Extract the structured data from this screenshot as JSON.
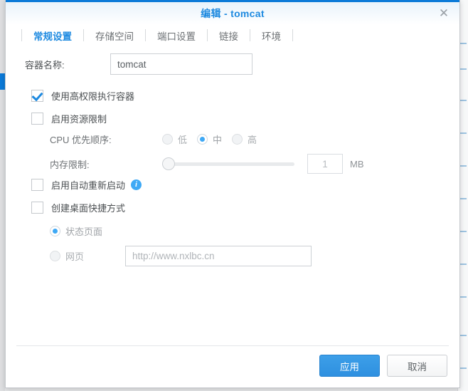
{
  "window": {
    "title": "编辑 - tomcat",
    "close_label": "✕"
  },
  "tabs": [
    {
      "label": "常规设置",
      "active": true
    },
    {
      "label": "存储空间",
      "active": false
    },
    {
      "label": "端口设置",
      "active": false
    },
    {
      "label": "链接",
      "active": false
    },
    {
      "label": "环境",
      "active": false
    }
  ],
  "form": {
    "container_name": {
      "label": "容器名称:",
      "value": "tomcat",
      "placeholder": ""
    },
    "high_privilege": {
      "label": "使用高权限执行容器",
      "checked": true
    },
    "resource_limit": {
      "label": "启用资源限制",
      "checked": false
    },
    "cpu_priority": {
      "label": "CPU 优先顺序:",
      "options": [
        "低",
        "中",
        "高"
      ],
      "selected": "中"
    },
    "memory_limit": {
      "label": "内存限制:",
      "value": "1",
      "unit": "MB",
      "slider_percent": 0
    },
    "auto_restart": {
      "label": "启用自动重新启动",
      "checked": false,
      "info_glyph": "i"
    },
    "desktop_shortcut": {
      "label": "创建桌面快捷方式",
      "checked": false
    },
    "shortcut_target": {
      "options": [
        {
          "label": "状态页面",
          "selected": true
        },
        {
          "label": "网页",
          "selected": false
        }
      ],
      "url_placeholder": "http://www.nxlbc.cn",
      "url_value": ""
    }
  },
  "footer": {
    "apply_label": "应用",
    "cancel_label": "取消"
  },
  "colors": {
    "accent": "#1e8ae0",
    "primary_button": "#2e90e0",
    "title_text": "#1e8ae0",
    "info_icon": "#3fa9f5"
  }
}
